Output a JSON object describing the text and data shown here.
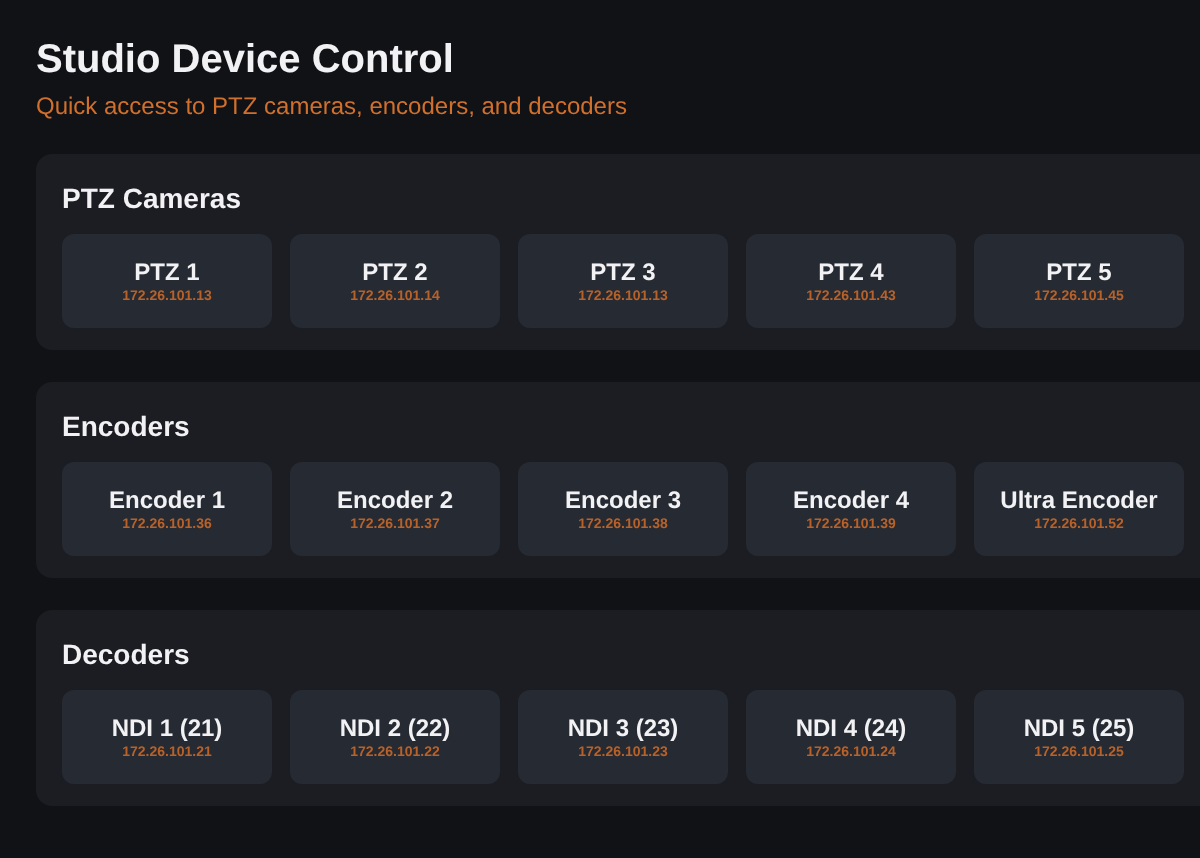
{
  "header": {
    "title": "Studio Device Control",
    "subtitle": "Quick access to PTZ cameras, encoders, and decoders"
  },
  "sections": [
    {
      "title": "PTZ Cameras",
      "devices": [
        {
          "name": "PTZ 1",
          "ip": "172.26.101.13"
        },
        {
          "name": "PTZ 2",
          "ip": "172.26.101.14"
        },
        {
          "name": "PTZ 3",
          "ip": "172.26.101.13"
        },
        {
          "name": "PTZ 4",
          "ip": "172.26.101.43"
        },
        {
          "name": "PTZ 5",
          "ip": "172.26.101.45"
        }
      ]
    },
    {
      "title": "Encoders",
      "devices": [
        {
          "name": "Encoder 1",
          "ip": "172.26.101.36"
        },
        {
          "name": "Encoder 2",
          "ip": "172.26.101.37"
        },
        {
          "name": "Encoder 3",
          "ip": "172.26.101.38"
        },
        {
          "name": "Encoder 4",
          "ip": "172.26.101.39"
        },
        {
          "name": "Ultra Encoder",
          "ip": "172.26.101.52"
        }
      ]
    },
    {
      "title": "Decoders",
      "devices": [
        {
          "name": "NDI 1 (21)",
          "ip": "172.26.101.21"
        },
        {
          "name": "NDI 2 (22)",
          "ip": "172.26.101.22"
        },
        {
          "name": "NDI 3 (23)",
          "ip": "172.26.101.23"
        },
        {
          "name": "NDI 4 (24)",
          "ip": "172.26.101.24"
        },
        {
          "name": "NDI 5 (25)",
          "ip": "172.26.101.25"
        }
      ]
    }
  ]
}
